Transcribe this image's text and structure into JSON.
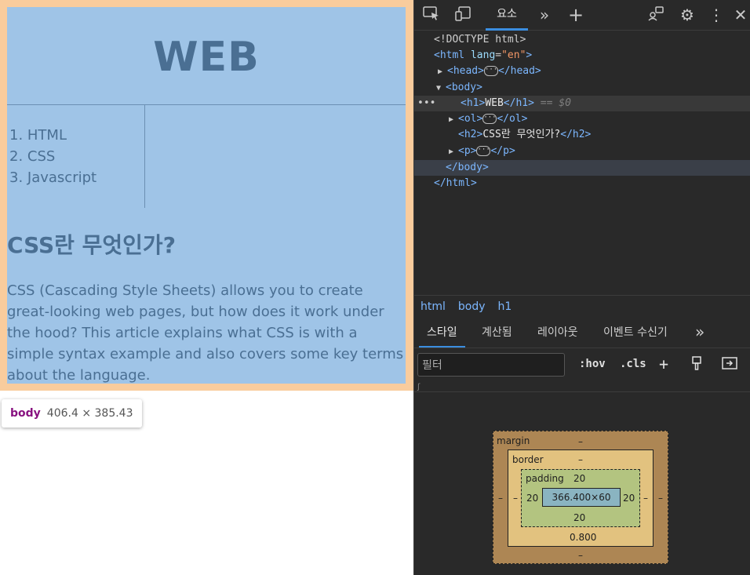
{
  "page": {
    "heading": "WEB",
    "nav_items": [
      "1. HTML",
      "2. CSS",
      "3. Javascript"
    ],
    "article_title": "CSS란 무엇인가?",
    "article_body": "CSS (Cascading Style Sheets) allows you to create great-looking web pages, but how does it work under the hood? This article explains what CSS is with a simple syntax example and also covers some key terms about the language."
  },
  "tooltip": {
    "tag": "body",
    "size": "406.4 × 385.43"
  },
  "devtools": {
    "tab_elements": "요소",
    "dom": {
      "doctype": "<!DOCTYPE html>",
      "html_tag_open": "<html",
      "lang_attr": "lang",
      "lang_value": "\"en\"",
      "gt": ">",
      "head_open": "<head>",
      "head_close": "</head>",
      "body_open": "<body>",
      "h1_open": "<h1>",
      "h1_text": "WEB",
      "h1_close": "</h1>",
      "h1_eq": "== $0",
      "ol_open": "<ol>",
      "ol_close": "</ol>",
      "h2_open": "<h2>",
      "h2_text": "CSS란 무엇인가?",
      "h2_close": "</h2>",
      "p_open": "<p>",
      "p_close": "</p>",
      "body_close": "</body>",
      "html_close": "</html>",
      "ellipsis": "···"
    },
    "breadcrumbs": [
      "html",
      "body",
      "h1"
    ],
    "sub_tabs": [
      "스타일",
      "계산됨",
      "레이아웃",
      "이벤트 수신기"
    ],
    "filter_placeholder": "필터",
    "hov": ":hov",
    "cls": ".cls",
    "box_model": {
      "margin_label": "margin",
      "margin_top": "–",
      "margin_bottom": "–",
      "margin_left": "–",
      "margin_right": "–",
      "border_label": "border",
      "border_top": "–",
      "border_bottom": "0.800",
      "border_left": "–",
      "border_right": "–",
      "padding_label": "padding",
      "padding_top": "20",
      "padding_bottom": "20",
      "padding_left": "20",
      "padding_right": "20",
      "content": "366.400×60"
    }
  },
  "colors": {
    "highlight_margin": "#f9cc9d",
    "highlight_content": "#9fc4e7",
    "accent": "#3b8ee0"
  },
  "icons": [
    "inspect-icon",
    "device-toggle-icon",
    "more-tabs-icon",
    "add-tab-icon",
    "feedback-icon",
    "settings-icon",
    "kebab-menu-icon",
    "close-icon",
    "new-style-rule-icon",
    "paint-brush-icon",
    "toggle-sidebar-icon"
  ]
}
